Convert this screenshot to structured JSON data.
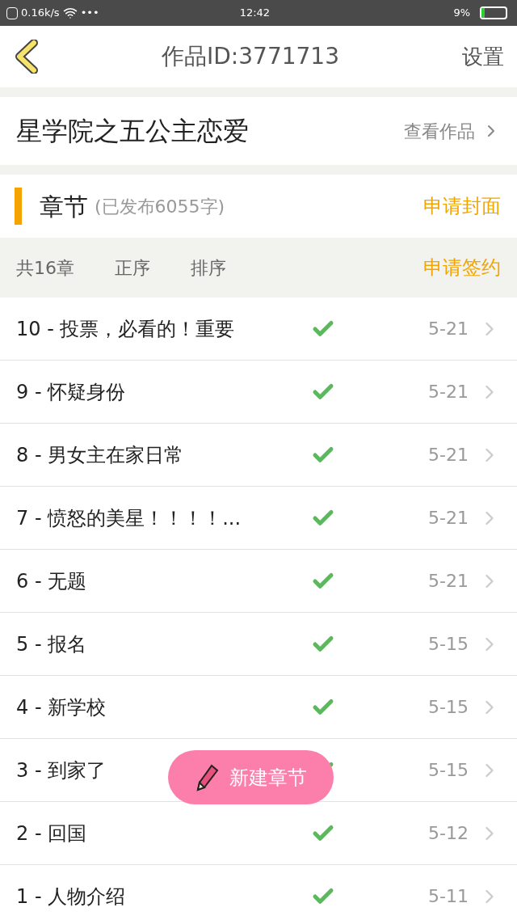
{
  "status_bar": {
    "speed": "0.16k/s",
    "dots": "•••",
    "time": "12:42",
    "battery": "9%"
  },
  "header": {
    "title": "作品ID:3771713",
    "action": "设置"
  },
  "work": {
    "title": "星学院之五公主恋爱",
    "link": "查看作品"
  },
  "section": {
    "title": "章节",
    "subtitle": "(已发布6055字)",
    "action": "申请封面"
  },
  "toolbar": {
    "count": "共16章",
    "order": "正序",
    "sort": "排序",
    "action": "申请签约"
  },
  "chapters": [
    {
      "title": "10 - 投票，必看的！重要",
      "published": true,
      "date": "5-21"
    },
    {
      "title": "9 - 怀疑身份",
      "published": true,
      "date": "5-21"
    },
    {
      "title": "8 - 男女主在家日常",
      "published": true,
      "date": "5-21"
    },
    {
      "title": "7 - 愤怒的美星！！！！...",
      "published": true,
      "date": "5-21"
    },
    {
      "title": "6 - 无题",
      "published": true,
      "date": "5-21"
    },
    {
      "title": "5 - 报名",
      "published": true,
      "date": "5-15"
    },
    {
      "title": "4 - 新学校",
      "published": true,
      "date": "5-15"
    },
    {
      "title": "3 - 到家了",
      "published": true,
      "date": "5-15"
    },
    {
      "title": "2 - 回国",
      "published": true,
      "date": "5-12"
    },
    {
      "title": "1 - 人物介绍",
      "published": true,
      "date": "5-11"
    }
  ],
  "fab": {
    "label": "新建章节"
  }
}
